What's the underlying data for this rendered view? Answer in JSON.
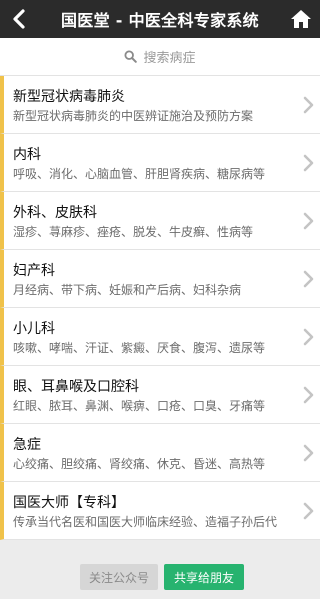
{
  "header": {
    "title": "国医堂 - 中医全科专家系统"
  },
  "search": {
    "placeholder": "搜索病症"
  },
  "categories": [
    {
      "name": "新型冠状病毒肺炎",
      "desc": "新型冠状病毒肺炎的中医辨证施治及预防方案"
    },
    {
      "name": "内科",
      "desc": "呼吸、消化、心脑血管、肝胆肾疾病、糖尿病等"
    },
    {
      "name": "外科、皮肤科",
      "desc": "湿疹、荨麻疹、痤疮、脱发、牛皮癣、性病等"
    },
    {
      "name": "妇产科",
      "desc": "月经病、带下病、妊娠和产后病、妇科杂病"
    },
    {
      "name": "小儿科",
      "desc": "咳嗽、哮喘、汗证、紫癜、厌食、腹泻、遗尿等"
    },
    {
      "name": "眼、耳鼻喉及口腔科",
      "desc": "红眼、脓耳、鼻渊、喉痹、口疮、口臭、牙痛等"
    },
    {
      "name": "急症",
      "desc": "心绞痛、胆绞痛、肾绞痛、休克、昏迷、高热等"
    },
    {
      "name": "国医大师【专科】",
      "desc": "传承当代名医和国医大师临床经验、造福子孙后代"
    }
  ],
  "footer": {
    "follow_label": "关注公众号",
    "share_label": "共享给朋友"
  },
  "colors": {
    "header_bg": "#2b2b2b",
    "accent_bar": "#f0c24a",
    "share_button": "#27b36f"
  },
  "icons": {
    "back": "back-arrow-icon",
    "home": "home-icon",
    "search": "search-icon",
    "chevron": "chevron-right-icon"
  }
}
